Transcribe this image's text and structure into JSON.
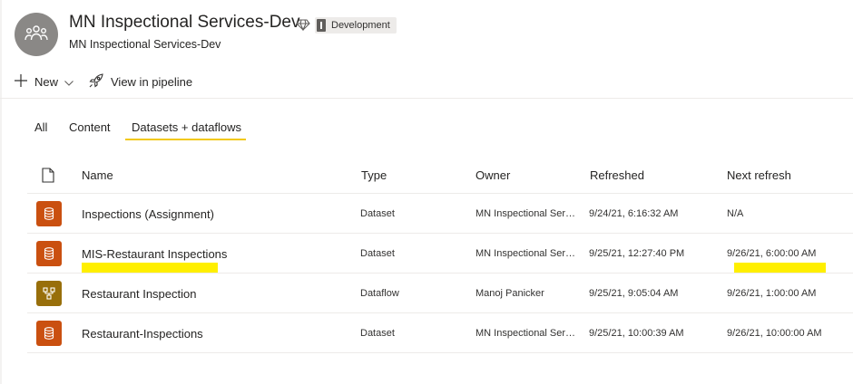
{
  "workspace": {
    "title": "MN Inspectional Services-Dev",
    "subtitle": "MN Inspectional Services-Dev",
    "environment_badge": "Development",
    "avatar_icon": "group-icon",
    "premium_icon": "diamond-icon"
  },
  "toolbar": {
    "new_label": "New",
    "view_pipeline_label": "View in pipeline"
  },
  "tabs": [
    {
      "label": "All",
      "active": false
    },
    {
      "label": "Content",
      "active": false
    },
    {
      "label": "Datasets + dataflows",
      "active": true
    }
  ],
  "table": {
    "columns": [
      "Name",
      "Type",
      "Owner",
      "Refreshed",
      "Next refresh"
    ],
    "rows": [
      {
        "icon": "dataset-icon",
        "name": "Inspections (Assignment)",
        "type": "Dataset",
        "owner": "MN Inspectional Serv...",
        "refreshed": "9/24/21, 6:16:32 AM",
        "next_refresh": "N/A"
      },
      {
        "icon": "dataset-icon",
        "name": "MIS-Restaurant Inspections",
        "type": "Dataset",
        "owner": "MN Inspectional Serv...",
        "refreshed": "9/25/21, 12:27:40 PM",
        "next_refresh": "9/26/21, 6:00:00 AM"
      },
      {
        "icon": "dataflow-icon",
        "name": "Restaurant Inspection",
        "type": "Dataflow",
        "owner": "Manoj Panicker",
        "refreshed": "9/25/21, 9:05:04 AM",
        "next_refresh": "9/26/21, 1:00:00 AM"
      },
      {
        "icon": "dataset-icon",
        "name": "Restaurant-Inspections",
        "type": "Dataset",
        "owner": "MN Inspectional Serv...",
        "refreshed": "9/25/21, 10:00:39 AM",
        "next_refresh": "9/26/21, 10:00:00 AM"
      }
    ]
  },
  "colors": {
    "dataset_icon_bg": "#ca5010",
    "dataflow_icon_bg": "#986f0b",
    "tab_underline": "#f2c811",
    "highlight": "#ffef00"
  }
}
